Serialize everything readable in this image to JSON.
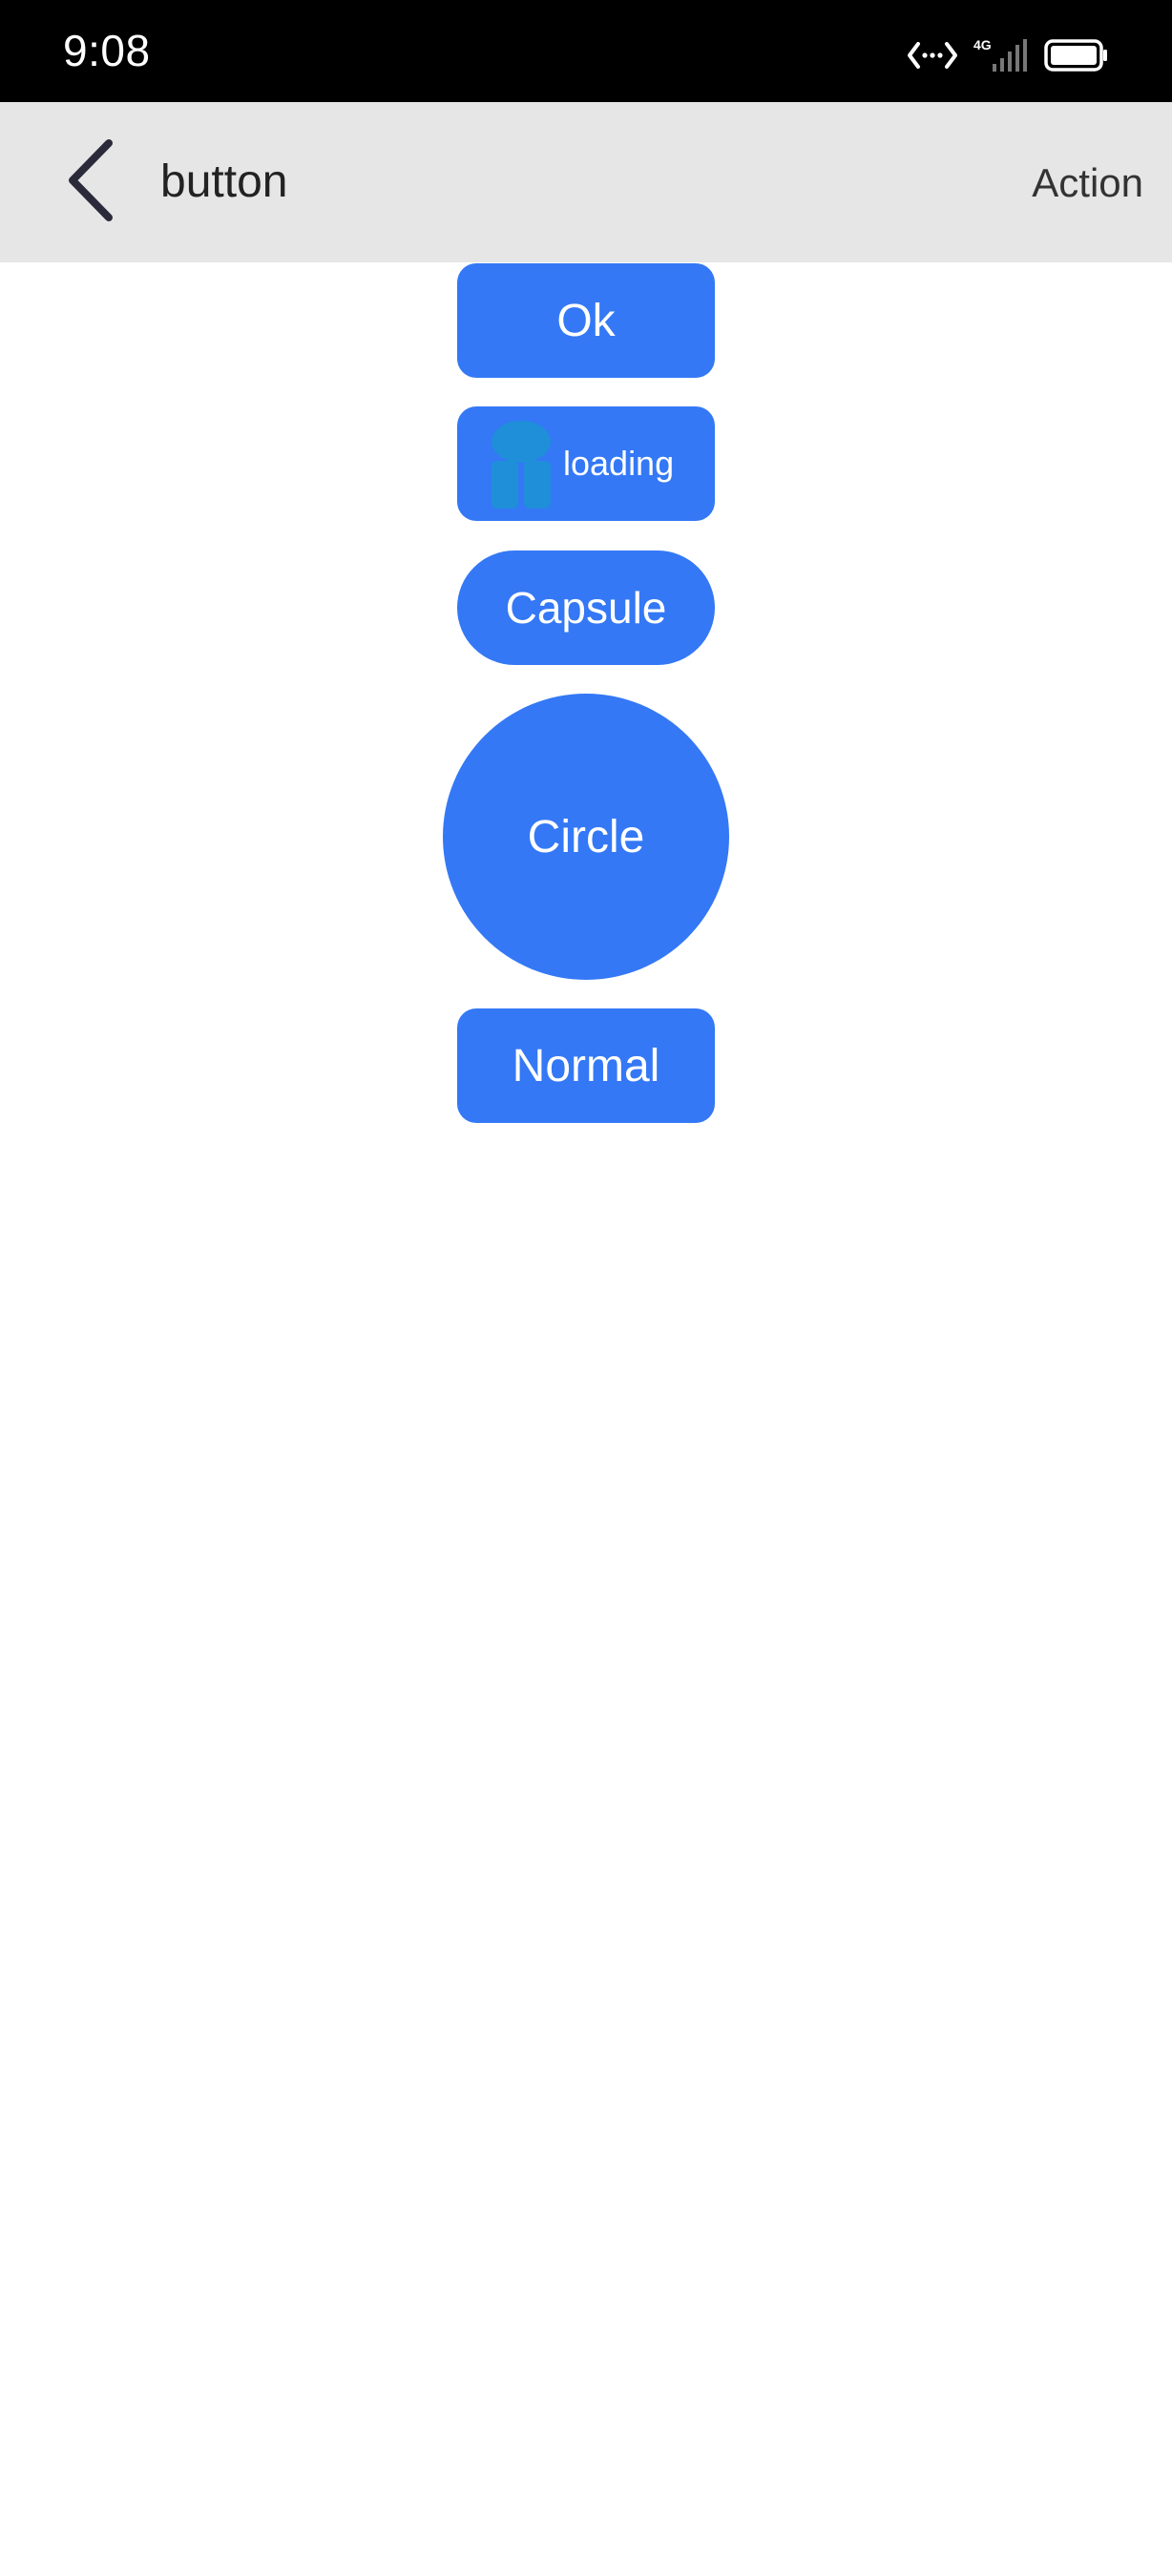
{
  "status_bar": {
    "time": "9:08",
    "network_label": "4G",
    "icons": [
      "data-transfer-icon",
      "signal-4g-icon",
      "battery-icon"
    ]
  },
  "app_bar": {
    "back_icon": "chevron-left-icon",
    "title": "button",
    "action_label": "Action"
  },
  "buttons": {
    "ok_label": "Ok",
    "loading_label": "loading",
    "loading_icon": "loading-spinner-icon",
    "capsule_label": "Capsule",
    "circle_label": "Circle",
    "normal_label": "Normal"
  },
  "colors": {
    "button_background": "#3478f6",
    "button_text": "#ffffff",
    "app_bar_background": "#e6e6e6",
    "status_bar_background": "#000000",
    "loading_icon": "#1e8fd8"
  }
}
